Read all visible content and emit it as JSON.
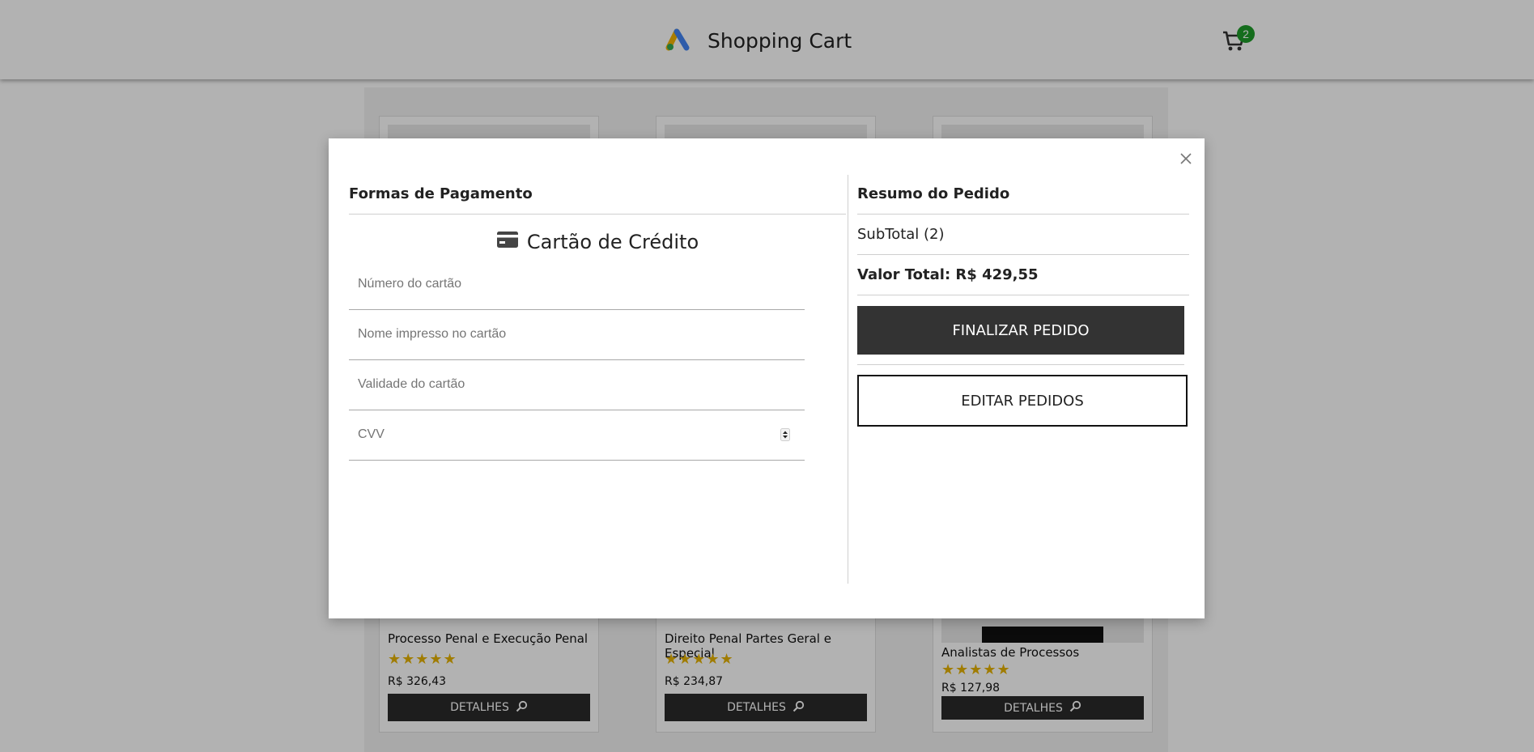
{
  "header": {
    "title": "Shopping Cart",
    "cart_count": "2"
  },
  "products": [
    {
      "name": "Processo Penal e Execução Penal",
      "stars": "★★★★★",
      "price": "R$ 326,43",
      "button": "DETALHES",
      "cover_color": "#1c3a8a"
    },
    {
      "name": "Direito Penal Partes Geral e Especial",
      "stars": "★★★★★",
      "price": "R$ 234,87",
      "button": "DETALHES",
      "cover_color": "#0b1a3a"
    },
    {
      "name": "Analistas de Processos",
      "stars": "★★★★★",
      "price": "R$ 127,98",
      "button": "DETALHES",
      "cover_color": "#1aa0b8"
    }
  ],
  "modal": {
    "payment": {
      "title": "Formas de Pagamento",
      "method": "Cartão de Crédito",
      "fields": {
        "card_number": "Número do cartão",
        "card_name": "Nome impresso no cartão",
        "card_expiry": "Validade do cartão",
        "cvv": "CVV"
      }
    },
    "summary": {
      "title": "Resumo do Pedido",
      "subtotal": "SubTotal (2)",
      "total_label": "Valor Total: R$ 429,55",
      "finalize_button": "FINALIZAR PEDIDO",
      "edit_button": "EDITAR PEDIDOS"
    }
  },
  "colors": {
    "badge": "#1f9d2a",
    "button_dark": "#333333",
    "stars": "#e6b200"
  }
}
